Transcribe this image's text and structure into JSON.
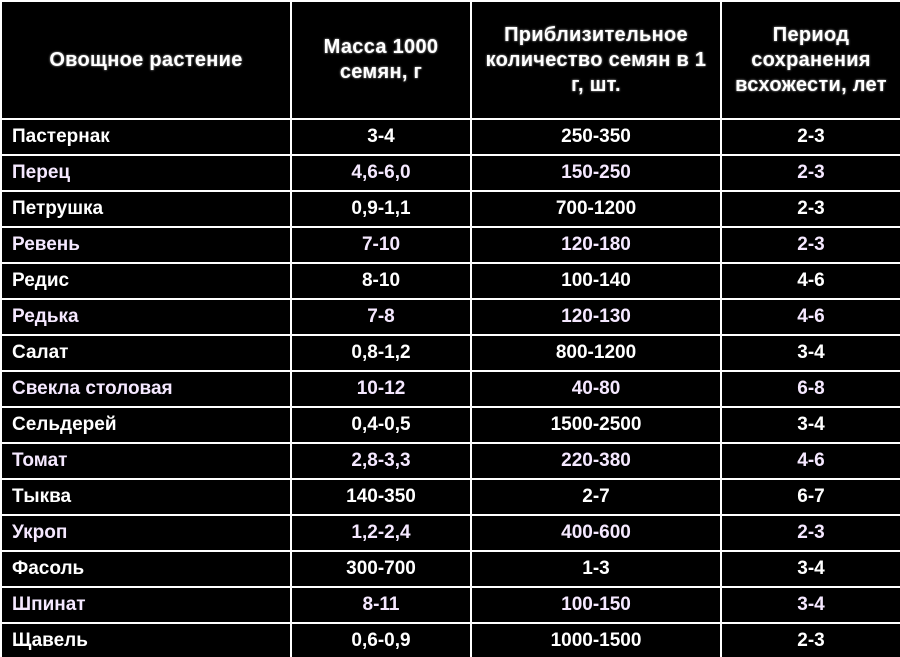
{
  "headers": {
    "col1": "Овощное растение",
    "col2": "Масса 1000 семян, г",
    "col3": "Приблизительное количество семян в 1 г, шт.",
    "col4": "Период сохранения всхожести, лет"
  },
  "rows": [
    {
      "name": "Пастернак",
      "mass": "3-4",
      "count": "250-350",
      "years": "2-3"
    },
    {
      "name": "Перец",
      "mass": "4,6-6,0",
      "count": "150-250",
      "years": "2-3"
    },
    {
      "name": "Петрушка",
      "mass": "0,9-1,1",
      "count": "700-1200",
      "years": "2-3"
    },
    {
      "name": "Ревень",
      "mass": "7-10",
      "count": "120-180",
      "years": "2-3"
    },
    {
      "name": "Редис",
      "mass": "8-10",
      "count": "100-140",
      "years": "4-6"
    },
    {
      "name": "Редька",
      "mass": "7-8",
      "count": "120-130",
      "years": "4-6"
    },
    {
      "name": "Салат",
      "mass": "0,8-1,2",
      "count": "800-1200",
      "years": "3-4"
    },
    {
      "name": "Свекла столовая",
      "mass": "10-12",
      "count": "40-80",
      "years": "6-8"
    },
    {
      "name": "Сельдерей",
      "mass": "0,4-0,5",
      "count": "1500-2500",
      "years": "3-4"
    },
    {
      "name": "Томат",
      "mass": "2,8-3,3",
      "count": "220-380",
      "years": "4-6"
    },
    {
      "name": "Тыква",
      "mass": "140-350",
      "count": "2-7",
      "years": "6-7"
    },
    {
      "name": "Укроп",
      "mass": "1,2-2,4",
      "count": "400-600",
      "years": "2-3"
    },
    {
      "name": "Фасоль",
      "mass": "300-700",
      "count": "1-3",
      "years": "3-4"
    },
    {
      "name": "Шпинат",
      "mass": "8-11",
      "count": "100-150",
      "years": "3-4"
    },
    {
      "name": "Щавель",
      "mass": "0,6-0,9",
      "count": "1000-1500",
      "years": "2-3"
    }
  ],
  "chart_data": {
    "type": "table",
    "title": "",
    "columns": [
      "Овощное растение",
      "Масса 1000 семян, г",
      "Приблизительное количество семян в 1 г, шт.",
      "Период сохранения всхожести, лет"
    ],
    "rows": [
      [
        "Пастернак",
        "3-4",
        "250-350",
        "2-3"
      ],
      [
        "Перец",
        "4,6-6,0",
        "150-250",
        "2-3"
      ],
      [
        "Петрушка",
        "0,9-1,1",
        "700-1200",
        "2-3"
      ],
      [
        "Ревень",
        "7-10",
        "120-180",
        "2-3"
      ],
      [
        "Редис",
        "8-10",
        "100-140",
        "4-6"
      ],
      [
        "Редька",
        "7-8",
        "120-130",
        "4-6"
      ],
      [
        "Салат",
        "0,8-1,2",
        "800-1200",
        "3-4"
      ],
      [
        "Свекла столовая",
        "10-12",
        "40-80",
        "6-8"
      ],
      [
        "Сельдерей",
        "0,4-0,5",
        "1500-2500",
        "3-4"
      ],
      [
        "Томат",
        "2,8-3,3",
        "220-380",
        "4-6"
      ],
      [
        "Тыква",
        "140-350",
        "2-7",
        "6-7"
      ],
      [
        "Укроп",
        "1,2-2,4",
        "400-600",
        "2-3"
      ],
      [
        "Фасоль",
        "300-700",
        "1-3",
        "3-4"
      ],
      [
        "Шпинат",
        "8-11",
        "100-150",
        "3-4"
      ],
      [
        "Щавель",
        "0,6-0,9",
        "1000-1500",
        "2-3"
      ]
    ]
  }
}
